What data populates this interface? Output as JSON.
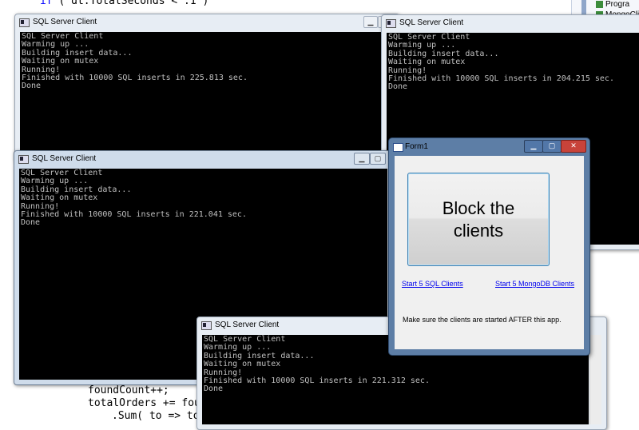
{
  "editor": {
    "top_line_keyword": "if",
    "top_line_code": " ( dt.TotalSeconds < .1 )",
    "line_found_count": "foundCount++;",
    "line_total_orders": "totalOrders += fou",
    "line_sum": ".Sum( to => to"
  },
  "solution_explorer": {
    "item1": "Progra",
    "item2": "MongoCli"
  },
  "windows": [
    {
      "title": "SQL Server Client",
      "lines": "SQL Server Client\nWarming up ...\nBuilding insert data...\nWaiting on mutex\nRunning!\nFinished with 10000 SQL inserts in 225.813 sec.\nDone"
    },
    {
      "title": "SQL Server Client",
      "lines": "SQL Server Client\nWarming up ...\nBuilding insert data...\nWaiting on mutex\nRunning!\nFinished with 10000 SQL inserts in 204.215 sec.\nDone"
    },
    {
      "title": "SQL Server Client",
      "lines": "SQL Server Client\nWarming up ...\nBuilding insert data...\nWaiting on mutex\nRunning!\nFinished with 10000 SQL inserts in 221.041 sec.\nDone"
    },
    {
      "title": "SQL Server Client",
      "lines": "SQL Server Client\nWarming up ...\nBuilding insert data...\nWaiting on mutex\nRunning!\nFinished with 10000 SQL inserts in 221.312 sec.\nDone"
    }
  ],
  "form": {
    "title": "Form1",
    "block_button": "Block the clients",
    "link_sql": "Start 5 SQL Clients",
    "link_mongo": "Start 5 MongoDB Clients",
    "note": "Make sure the clients are started AFTER this app."
  },
  "icons": {
    "minimize": "minimize-icon",
    "maximize": "maximize-icon",
    "close": "close-icon",
    "console": "console-window-icon",
    "form": "form-window-icon"
  },
  "colors": {
    "console_bg": "#000000",
    "console_text": "#c0c0c0",
    "link": "#0000ee",
    "button_border": "#3c7fb1"
  }
}
